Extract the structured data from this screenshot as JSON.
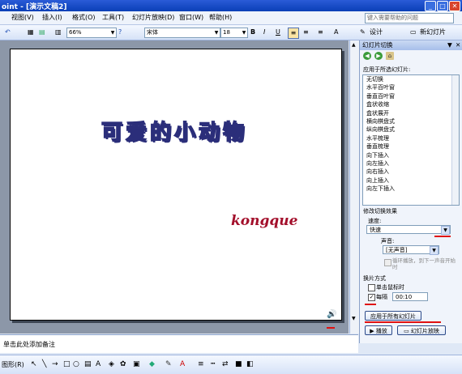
{
  "window": {
    "title": "oint - [演示文稿2]",
    "min": "_",
    "max": "□",
    "close": "✕"
  },
  "menu": {
    "items": [
      "视图(V)",
      "插入(I)",
      "格式(O)",
      "工具(T)",
      "幻灯片放映(D)",
      "窗口(W)",
      "帮助(H)"
    ],
    "help_placeholder": "键入需要帮助的问题"
  },
  "toolbar": {
    "zoom": "66%",
    "font": "宋体",
    "size": "18",
    "bold": "B",
    "italic": "I",
    "underline": "U",
    "design_label": "设计",
    "new_slide_label": "新幻灯片"
  },
  "slide": {
    "title": "可爱的小动物",
    "subtitle": "kongque"
  },
  "taskpane": {
    "title": "幻灯片切换",
    "apply_to_label": "应用于所选幻灯片:",
    "transitions": [
      "无切换",
      "水平百叶窗",
      "垂直百叶窗",
      "盒状收缩",
      "盒状展开",
      "横向棋盘式",
      "纵向棋盘式",
      "水平梳理",
      "垂直梳理",
      "向下插入",
      "向左插入",
      "向右插入",
      "向上插入",
      "向左下插入"
    ],
    "modify_label": "修改切换效果",
    "speed_label": "速度:",
    "speed_value": "快速",
    "sound_label": "声音:",
    "sound_value": "[无声音]",
    "loop_label": "循环播放，到下一声音开始时",
    "advance_label": "换片方式",
    "on_click_label": "单击鼠标时",
    "every_label": "每隔",
    "every_value": "00:10",
    "apply_all_label": "应用于所有幻灯片",
    "play_label": "播放",
    "slideshow_label": "幻灯片放映"
  },
  "notes": {
    "placeholder": "单击此处添加备注"
  },
  "drawbar": {
    "draw_label": "图形(R)"
  }
}
